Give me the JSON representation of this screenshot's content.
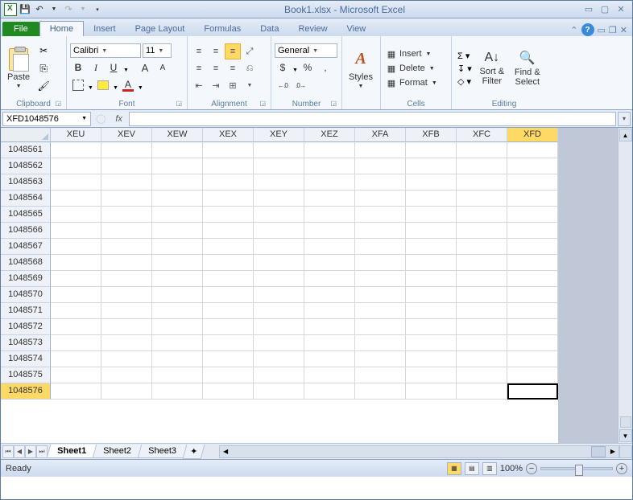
{
  "title": "Book1.xlsx - Microsoft Excel",
  "qat": {
    "save": "💾",
    "undo": "↶",
    "redo": "↷"
  },
  "tabs": {
    "file": "File",
    "home": "Home",
    "insert": "Insert",
    "pageLayout": "Page Layout",
    "formulas": "Formulas",
    "data": "Data",
    "review": "Review",
    "view": "View"
  },
  "ribbon": {
    "clipboard": {
      "label": "Clipboard",
      "paste": "Paste"
    },
    "font": {
      "label": "Font",
      "name": "Calibri",
      "size": "11",
      "bold": "B",
      "italic": "I",
      "underline": "U",
      "grow": "A",
      "shrink": "A"
    },
    "alignment": {
      "label": "Alignment"
    },
    "number": {
      "label": "Number",
      "format": "General",
      "currency": "$",
      "percent": "%",
      "comma": ",",
      "incDec": ".0 .00",
      "decDec": ".00 .0"
    },
    "styles": {
      "label": "Styles",
      "btn": "Styles"
    },
    "cells": {
      "label": "Cells",
      "insert": "Insert",
      "delete": "Delete",
      "format": "Format"
    },
    "editing": {
      "label": "Editing",
      "sortFilter": "Sort & Filter",
      "findSelect": "Find & Select",
      "sum": "Σ",
      "fill": "↧",
      "clear": "◇"
    }
  },
  "namebox": "XFD1048576",
  "fx": "fx",
  "columns": [
    "XEU",
    "XEV",
    "XEW",
    "XEX",
    "XEY",
    "XEZ",
    "XFA",
    "XFB",
    "XFC",
    "XFD"
  ],
  "rows": [
    "1048561",
    "1048562",
    "1048563",
    "1048564",
    "1048565",
    "1048566",
    "1048567",
    "1048568",
    "1048569",
    "1048570",
    "1048571",
    "1048572",
    "1048573",
    "1048574",
    "1048575",
    "1048576"
  ],
  "selectedCol": "XFD",
  "selectedRow": "1048576",
  "sheets": {
    "s1": "Sheet1",
    "s2": "Sheet2",
    "s3": "Sheet3"
  },
  "status": {
    "ready": "Ready",
    "zoom": "100%"
  }
}
